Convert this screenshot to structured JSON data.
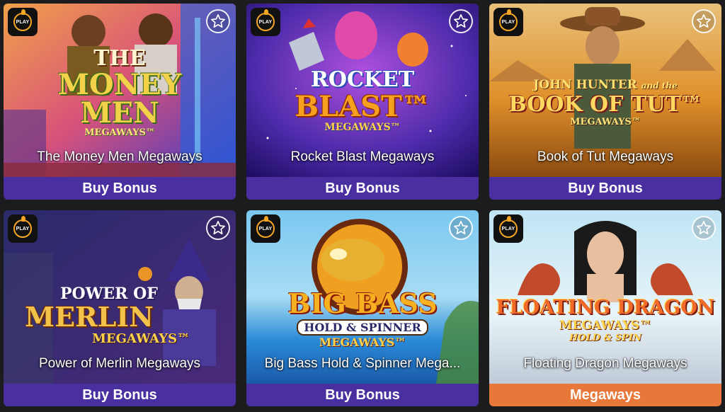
{
  "play_label": "PLAY",
  "colors": {
    "badge_purple": "#4a2fa0",
    "badge_orange": "#e8773a",
    "background": "#1c1c1e"
  },
  "games": [
    {
      "title": "The Money Men Megaways",
      "badge": "Buy Bonus",
      "logo_lines": [
        "THE",
        "MONEY",
        "MEN",
        "MEGAWAYS™"
      ],
      "icons": [
        "play-logo-icon",
        "star-icon"
      ]
    },
    {
      "title": "Rocket Blast Megaways",
      "badge": "Buy Bonus",
      "logo_lines": [
        "ROCKET",
        "BLAST™",
        "MEGAWAYS™"
      ],
      "icons": [
        "play-logo-icon",
        "star-icon"
      ]
    },
    {
      "title": "Book of Tut Megaways",
      "badge": "Buy Bonus",
      "logo_lines": [
        "JOHN HUNTER",
        "and the",
        "BOOK OF TUT™",
        "MEGAWAYS™"
      ],
      "icons": [
        "play-logo-icon",
        "star-icon"
      ]
    },
    {
      "title": "Power of Merlin Megaways",
      "badge": "Buy Bonus",
      "logo_lines": [
        "POWER OF",
        "MERLIN",
        "MEGAWAYS™"
      ],
      "icons": [
        "play-logo-icon",
        "star-icon"
      ]
    },
    {
      "title": "Big Bass Hold & Spinner Mega...",
      "badge": "Buy Bonus",
      "logo_lines": [
        "BIG BASS",
        "HOLD & SPINNER",
        "MEGAWAYS™"
      ],
      "icons": [
        "play-logo-icon",
        "star-icon"
      ]
    },
    {
      "title": "Floating Dragon Megaways",
      "badge": "Megaways",
      "logo_lines": [
        "FLOATING DRAGON",
        "MEGAWAYS™",
        "HOLD & SPIN"
      ],
      "icons": [
        "play-logo-icon",
        "star-icon"
      ]
    }
  ]
}
